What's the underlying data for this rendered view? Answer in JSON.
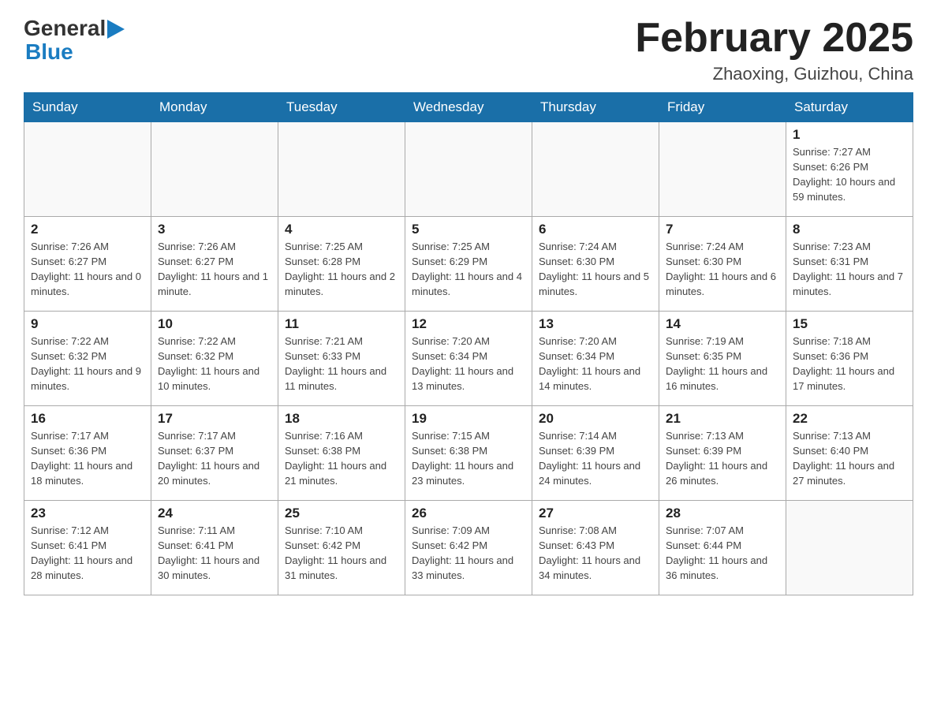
{
  "header": {
    "logo_general": "General",
    "logo_blue": "Blue",
    "title": "February 2025",
    "location": "Zhaoxing, Guizhou, China"
  },
  "days_of_week": [
    "Sunday",
    "Monday",
    "Tuesday",
    "Wednesday",
    "Thursday",
    "Friday",
    "Saturday"
  ],
  "weeks": [
    {
      "days": [
        {
          "date": "",
          "sunrise": "",
          "sunset": "",
          "daylight": ""
        },
        {
          "date": "",
          "sunrise": "",
          "sunset": "",
          "daylight": ""
        },
        {
          "date": "",
          "sunrise": "",
          "sunset": "",
          "daylight": ""
        },
        {
          "date": "",
          "sunrise": "",
          "sunset": "",
          "daylight": ""
        },
        {
          "date": "",
          "sunrise": "",
          "sunset": "",
          "daylight": ""
        },
        {
          "date": "",
          "sunrise": "",
          "sunset": "",
          "daylight": ""
        },
        {
          "date": "1",
          "sunrise": "Sunrise: 7:27 AM",
          "sunset": "Sunset: 6:26 PM",
          "daylight": "Daylight: 10 hours and 59 minutes."
        }
      ]
    },
    {
      "days": [
        {
          "date": "2",
          "sunrise": "Sunrise: 7:26 AM",
          "sunset": "Sunset: 6:27 PM",
          "daylight": "Daylight: 11 hours and 0 minutes."
        },
        {
          "date": "3",
          "sunrise": "Sunrise: 7:26 AM",
          "sunset": "Sunset: 6:27 PM",
          "daylight": "Daylight: 11 hours and 1 minute."
        },
        {
          "date": "4",
          "sunrise": "Sunrise: 7:25 AM",
          "sunset": "Sunset: 6:28 PM",
          "daylight": "Daylight: 11 hours and 2 minutes."
        },
        {
          "date": "5",
          "sunrise": "Sunrise: 7:25 AM",
          "sunset": "Sunset: 6:29 PM",
          "daylight": "Daylight: 11 hours and 4 minutes."
        },
        {
          "date": "6",
          "sunrise": "Sunrise: 7:24 AM",
          "sunset": "Sunset: 6:30 PM",
          "daylight": "Daylight: 11 hours and 5 minutes."
        },
        {
          "date": "7",
          "sunrise": "Sunrise: 7:24 AM",
          "sunset": "Sunset: 6:30 PM",
          "daylight": "Daylight: 11 hours and 6 minutes."
        },
        {
          "date": "8",
          "sunrise": "Sunrise: 7:23 AM",
          "sunset": "Sunset: 6:31 PM",
          "daylight": "Daylight: 11 hours and 7 minutes."
        }
      ]
    },
    {
      "days": [
        {
          "date": "9",
          "sunrise": "Sunrise: 7:22 AM",
          "sunset": "Sunset: 6:32 PM",
          "daylight": "Daylight: 11 hours and 9 minutes."
        },
        {
          "date": "10",
          "sunrise": "Sunrise: 7:22 AM",
          "sunset": "Sunset: 6:32 PM",
          "daylight": "Daylight: 11 hours and 10 minutes."
        },
        {
          "date": "11",
          "sunrise": "Sunrise: 7:21 AM",
          "sunset": "Sunset: 6:33 PM",
          "daylight": "Daylight: 11 hours and 11 minutes."
        },
        {
          "date": "12",
          "sunrise": "Sunrise: 7:20 AM",
          "sunset": "Sunset: 6:34 PM",
          "daylight": "Daylight: 11 hours and 13 minutes."
        },
        {
          "date": "13",
          "sunrise": "Sunrise: 7:20 AM",
          "sunset": "Sunset: 6:34 PM",
          "daylight": "Daylight: 11 hours and 14 minutes."
        },
        {
          "date": "14",
          "sunrise": "Sunrise: 7:19 AM",
          "sunset": "Sunset: 6:35 PM",
          "daylight": "Daylight: 11 hours and 16 minutes."
        },
        {
          "date": "15",
          "sunrise": "Sunrise: 7:18 AM",
          "sunset": "Sunset: 6:36 PM",
          "daylight": "Daylight: 11 hours and 17 minutes."
        }
      ]
    },
    {
      "days": [
        {
          "date": "16",
          "sunrise": "Sunrise: 7:17 AM",
          "sunset": "Sunset: 6:36 PM",
          "daylight": "Daylight: 11 hours and 18 minutes."
        },
        {
          "date": "17",
          "sunrise": "Sunrise: 7:17 AM",
          "sunset": "Sunset: 6:37 PM",
          "daylight": "Daylight: 11 hours and 20 minutes."
        },
        {
          "date": "18",
          "sunrise": "Sunrise: 7:16 AM",
          "sunset": "Sunset: 6:38 PM",
          "daylight": "Daylight: 11 hours and 21 minutes."
        },
        {
          "date": "19",
          "sunrise": "Sunrise: 7:15 AM",
          "sunset": "Sunset: 6:38 PM",
          "daylight": "Daylight: 11 hours and 23 minutes."
        },
        {
          "date": "20",
          "sunrise": "Sunrise: 7:14 AM",
          "sunset": "Sunset: 6:39 PM",
          "daylight": "Daylight: 11 hours and 24 minutes."
        },
        {
          "date": "21",
          "sunrise": "Sunrise: 7:13 AM",
          "sunset": "Sunset: 6:39 PM",
          "daylight": "Daylight: 11 hours and 26 minutes."
        },
        {
          "date": "22",
          "sunrise": "Sunrise: 7:13 AM",
          "sunset": "Sunset: 6:40 PM",
          "daylight": "Daylight: 11 hours and 27 minutes."
        }
      ]
    },
    {
      "days": [
        {
          "date": "23",
          "sunrise": "Sunrise: 7:12 AM",
          "sunset": "Sunset: 6:41 PM",
          "daylight": "Daylight: 11 hours and 28 minutes."
        },
        {
          "date": "24",
          "sunrise": "Sunrise: 7:11 AM",
          "sunset": "Sunset: 6:41 PM",
          "daylight": "Daylight: 11 hours and 30 minutes."
        },
        {
          "date": "25",
          "sunrise": "Sunrise: 7:10 AM",
          "sunset": "Sunset: 6:42 PM",
          "daylight": "Daylight: 11 hours and 31 minutes."
        },
        {
          "date": "26",
          "sunrise": "Sunrise: 7:09 AM",
          "sunset": "Sunset: 6:42 PM",
          "daylight": "Daylight: 11 hours and 33 minutes."
        },
        {
          "date": "27",
          "sunrise": "Sunrise: 7:08 AM",
          "sunset": "Sunset: 6:43 PM",
          "daylight": "Daylight: 11 hours and 34 minutes."
        },
        {
          "date": "28",
          "sunrise": "Sunrise: 7:07 AM",
          "sunset": "Sunset: 6:44 PM",
          "daylight": "Daylight: 11 hours and 36 minutes."
        },
        {
          "date": "",
          "sunrise": "",
          "sunset": "",
          "daylight": ""
        }
      ]
    }
  ]
}
